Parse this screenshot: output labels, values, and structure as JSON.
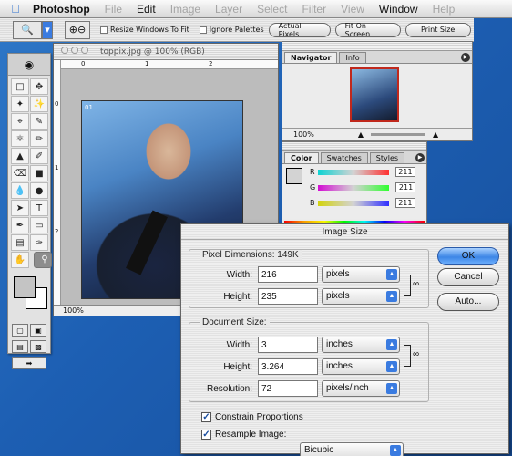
{
  "menubar": {
    "app": "Photoshop",
    "items": [
      "File",
      "Edit",
      "Image",
      "Layer",
      "Select",
      "Filter",
      "View",
      "Window",
      "Help"
    ]
  },
  "options": {
    "resize_label": "Resize Windows To Fit",
    "ignore_label": "Ignore Palettes",
    "actual_pixels": "Actual Pixels",
    "fit_on_screen": "Fit On Screen",
    "print_size": "Print Size"
  },
  "document": {
    "title": "toppix.jpg @ 100% (RGB)",
    "ruler_h": [
      "0",
      "1",
      "2"
    ],
    "ruler_v": [
      "0",
      "1",
      "2"
    ],
    "photo_label": "01",
    "status_zoom": "100%"
  },
  "navigator": {
    "tabs": [
      "Navigator",
      "Info"
    ],
    "zoom": "100%"
  },
  "colorpal": {
    "tabs": [
      "Color",
      "Swatches",
      "Styles"
    ],
    "channels": [
      {
        "name": "R",
        "value": "211"
      },
      {
        "name": "G",
        "value": "211"
      },
      {
        "name": "B",
        "value": "211"
      }
    ]
  },
  "dialog": {
    "title": "Image Size",
    "pixel_dims_label": "Pixel Dimensions:",
    "pixel_dims_size": "149K",
    "pd_width_label": "Width:",
    "pd_width_value": "216",
    "pd_width_unit": "pixels",
    "pd_height_label": "Height:",
    "pd_height_value": "235",
    "pd_height_unit": "pixels",
    "doc_size_label": "Document Size:",
    "ds_width_label": "Width:",
    "ds_width_value": "3",
    "ds_width_unit": "inches",
    "ds_height_label": "Height:",
    "ds_height_value": "3.264",
    "ds_height_unit": "inches",
    "res_label": "Resolution:",
    "res_value": "72",
    "res_unit": "pixels/inch",
    "constrain_label": "Constrain Proportions",
    "resample_label": "Resample Image:",
    "resample_value": "Bicubic",
    "ok": "OK",
    "cancel": "Cancel",
    "auto": "Auto..."
  }
}
